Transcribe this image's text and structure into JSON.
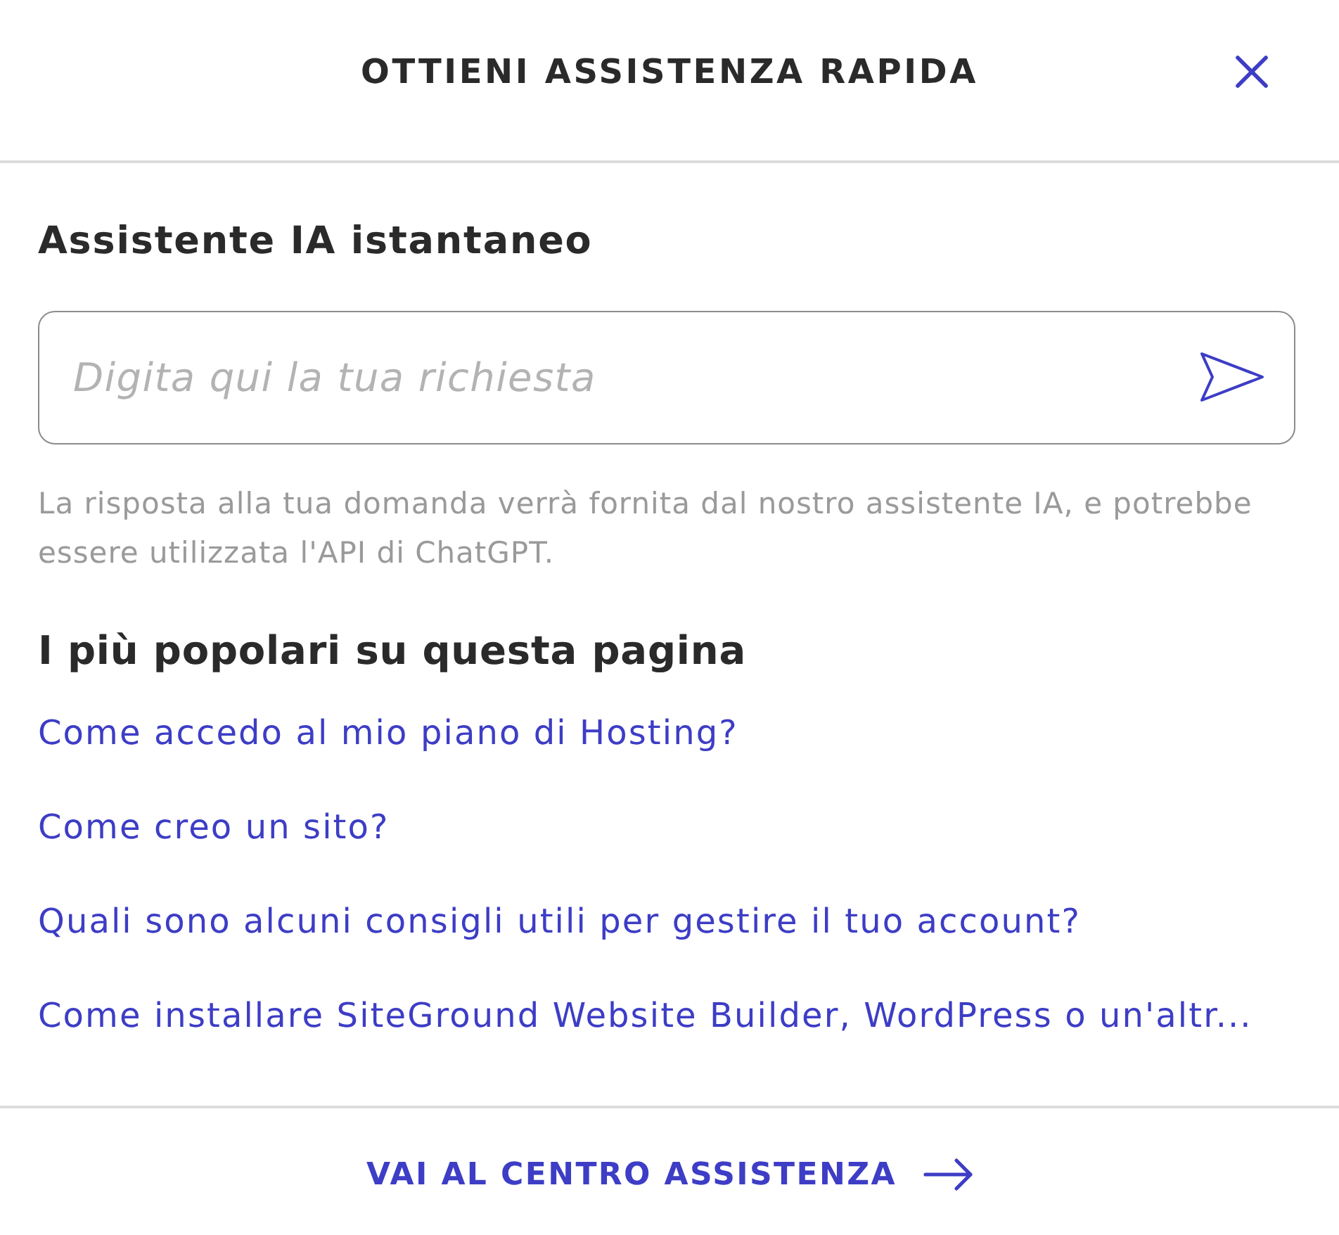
{
  "header": {
    "title": "OTTIENI ASSISTENZA RAPIDA"
  },
  "assistant": {
    "heading": "Assistente IA istantaneo",
    "input": {
      "placeholder": "Digita qui la tua richiesta"
    },
    "note": "La risposta alla tua domanda verrà fornita dal nostro assistente IA, e potrebbe essere utilizzata l'API di ChatGPT."
  },
  "popular": {
    "heading": "I più popolari su questa pagina",
    "links": [
      "Come accedo al mio piano di Hosting?",
      "Come creo un sito?",
      "Quali sono alcuni consigli utili per gestire il tuo account?",
      "Come installare SiteGround Website Builder, WordPress o un'altr..."
    ]
  },
  "footer": {
    "link": "VAI AL CENTRO ASSISTENZA"
  }
}
